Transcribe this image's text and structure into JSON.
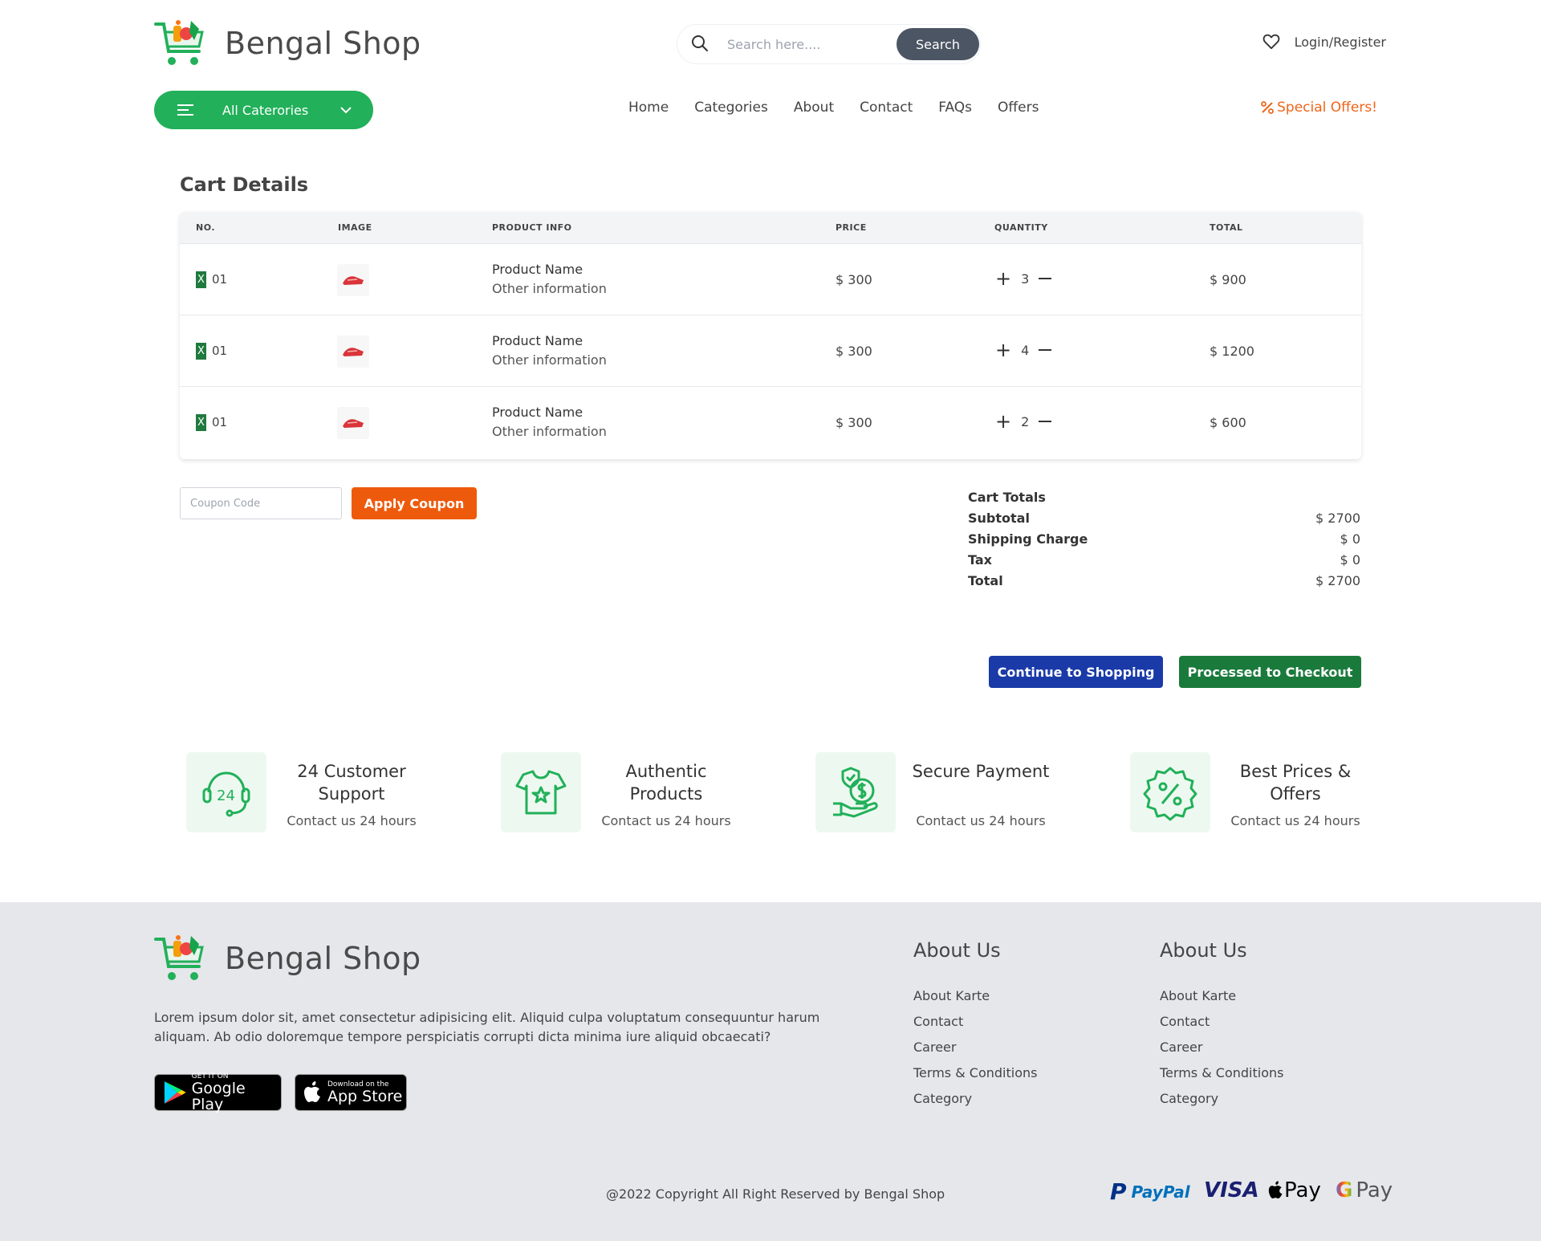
{
  "header": {
    "brand": "Bengal Shop",
    "search_placeholder": "Search here....",
    "search_button": "Search",
    "login": "Login/Register",
    "categories_button": "All Caterories",
    "nav": [
      "Home",
      "Categories",
      "About",
      "Contact",
      "FAQs",
      "Offers"
    ],
    "special_offers": "Special Offers!"
  },
  "cart": {
    "title": "Cart Details",
    "columns": [
      "NO.",
      "IMAGE",
      "PRODUCT INFO",
      "PRICE",
      "QUANTITY",
      "TOTAL"
    ],
    "rows": [
      {
        "remove": "X",
        "no": "01",
        "name": "Product Name",
        "info": "Other information",
        "price": "$ 300",
        "qty": "3",
        "total": "$ 900"
      },
      {
        "remove": "X",
        "no": "01",
        "name": "Product Name",
        "info": "Other information",
        "price": "$ 300",
        "qty": "4",
        "total": "$ 1200"
      },
      {
        "remove": "X",
        "no": "01",
        "name": "Product Name",
        "info": "Other information",
        "price": "$ 300",
        "qty": "2",
        "total": "$ 600"
      }
    ],
    "coupon_placeholder": "Coupon Code",
    "apply_coupon": "Apply Coupon",
    "totals": {
      "heading": "Cart Totals",
      "subtotal_label": "Subtotal",
      "subtotal": "$ 2700",
      "shipping_label": "Shipping Charge",
      "shipping": "$ 0",
      "tax_label": "Tax",
      "tax": "$ 0",
      "total_label": "Total",
      "total": "$ 2700"
    },
    "continue_button": "Continue to Shopping",
    "checkout_button": "Processed to Checkout"
  },
  "features": [
    {
      "title": "24 Customer Support",
      "sub": "Contact us 24 hours",
      "icon": "headset-24-icon"
    },
    {
      "title": "Authentic Products",
      "sub": "Contact us 24 hours",
      "icon": "tshirt-star-icon"
    },
    {
      "title": "Secure Payment",
      "sub": "Contact us 24 hours",
      "icon": "hand-dollar-shield-icon"
    },
    {
      "title": "Best Prices & Offers",
      "sub": "Contact us 24 hours",
      "icon": "percent-badge-icon"
    }
  ],
  "footer": {
    "brand": "Bengal Shop",
    "description": "Lorem ipsum dolor sit, amet consectetur adipisicing elit. Aliquid culpa voluptatum consequuntur harum aliquam. Ab odio doloremque tempore perspiciatis corrupti dicta minima iure aliquid obcaecati?",
    "google_play_small": "GET IT ON",
    "google_play_big": "Google Play",
    "app_store_small": "Download on the",
    "app_store_big": "App Store",
    "col1_title": "About Us",
    "col1_links": [
      "About Karte",
      "Contact",
      "Career",
      "Terms & Conditions",
      "Category"
    ],
    "col2_title": "About Us",
    "col2_links": [
      "About Karte",
      "Contact",
      "Career",
      "Terms & Conditions",
      "Category"
    ],
    "copyright": "@2022 Copyright All Right Reserved by Bengal Shop",
    "payments": {
      "paypal": "PayPal",
      "visa": "VISA",
      "applepay": "Pay",
      "gpay": "Pay"
    }
  },
  "colors": {
    "primary_green": "#22b05a",
    "orange": "#ee5a0c",
    "blue": "#1a3aa8",
    "dark_green": "#1a7a3c"
  }
}
